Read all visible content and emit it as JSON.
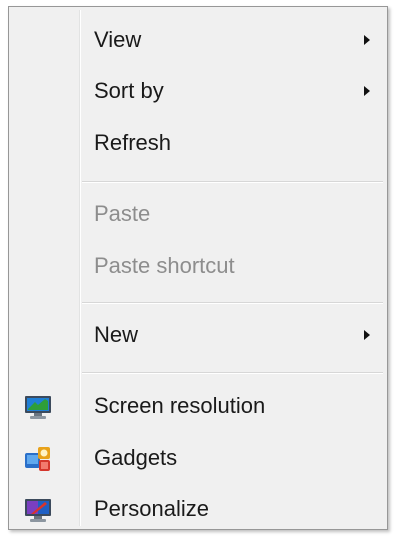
{
  "context_menu": {
    "items": [
      {
        "label": "View",
        "enabled": true,
        "has_submenu": true
      },
      {
        "label": "Sort by",
        "enabled": true,
        "has_submenu": true
      },
      {
        "label": "Refresh",
        "enabled": true,
        "has_submenu": false
      },
      {
        "label": "Paste",
        "enabled": false,
        "has_submenu": false
      },
      {
        "label": "Paste shortcut",
        "enabled": false,
        "has_submenu": false
      },
      {
        "label": "New",
        "enabled": true,
        "has_submenu": true
      },
      {
        "label": "Screen resolution",
        "enabled": true,
        "has_submenu": false,
        "icon": "screen-resolution-icon"
      },
      {
        "label": "Gadgets",
        "enabled": true,
        "has_submenu": false,
        "icon": "gadgets-icon"
      },
      {
        "label": "Personalize",
        "enabled": true,
        "has_submenu": false,
        "icon": "personalize-icon"
      }
    ]
  },
  "colors": {
    "menu_background": "#f0f0f0",
    "text_enabled": "#1a1a1a",
    "text_disabled": "#8d8d8d"
  }
}
